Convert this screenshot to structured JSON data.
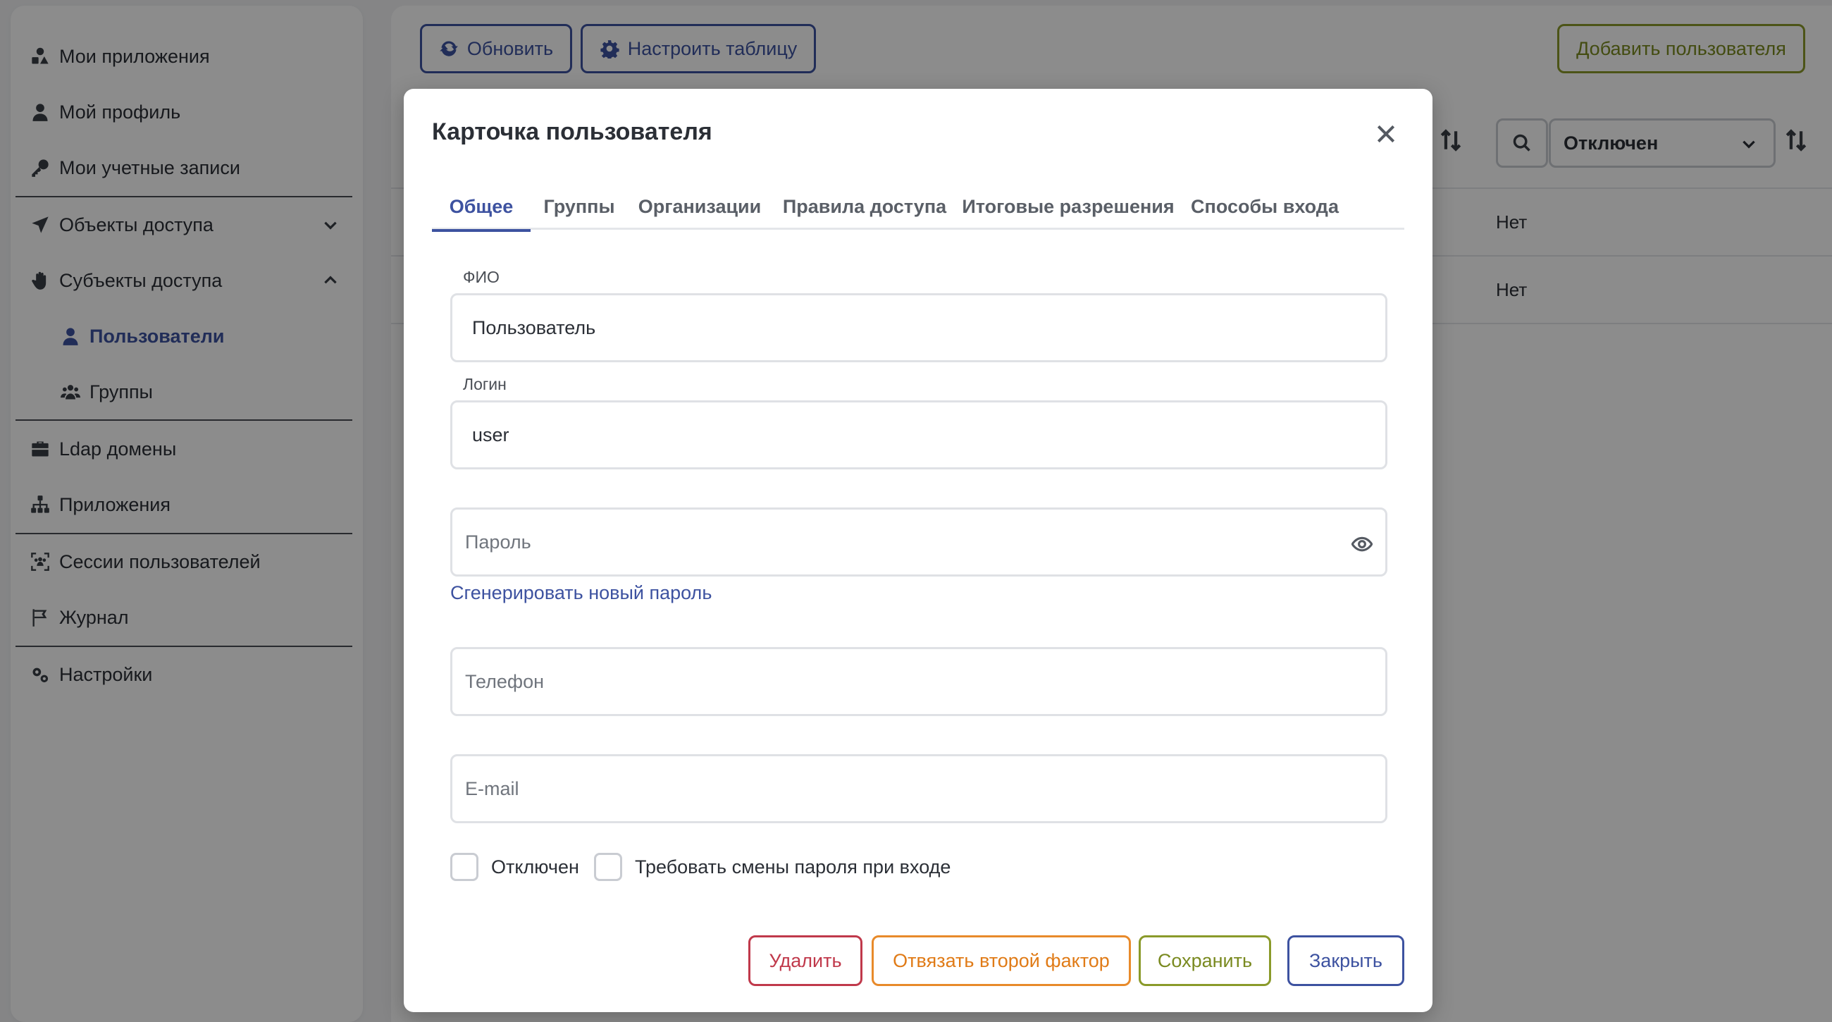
{
  "sidebar": {
    "items": [
      {
        "label": "Мои приложения",
        "icon": "apps-icon"
      },
      {
        "label": "Мой профиль",
        "icon": "user-icon"
      },
      {
        "label": "Мои учетные записи",
        "icon": "key-icon"
      },
      {
        "label": "Объекты доступа",
        "icon": "send-icon"
      },
      {
        "label": "Субъекты доступа",
        "icon": "hand-icon"
      },
      {
        "label": "Пользователи",
        "icon": "user-icon"
      },
      {
        "label": "Группы",
        "icon": "group-icon"
      },
      {
        "label": "Ldap домены",
        "icon": "briefcase-icon"
      },
      {
        "label": "Приложения",
        "icon": "sitemap-icon"
      },
      {
        "label": "Сессии пользователей",
        "icon": "sessions-icon"
      },
      {
        "label": "Журнал",
        "icon": "flag-icon"
      },
      {
        "label": "Настройки",
        "icon": "gears-icon"
      }
    ]
  },
  "toolbar": {
    "refresh_label": "Обновить",
    "configure_label": "Настроить таблицу",
    "add_user_label": "Добавить пользователя"
  },
  "table": {
    "filter_value": "Отключен",
    "rows": [
      {
        "disabled": "Нет"
      },
      {
        "disabled": "Нет"
      }
    ]
  },
  "modal": {
    "title": "Карточка пользователя",
    "tabs": [
      "Общее",
      "Группы",
      "Организации",
      "Правила доступа",
      "Итоговые разрешения",
      "Способы входа"
    ],
    "fio_label": "ФИО",
    "fio_value": "Пользователь",
    "login_label": "Логин",
    "login_value": "user",
    "password_placeholder": "Пароль",
    "generate_link": "Сгенерировать новый пароль",
    "phone_placeholder": "Телефон",
    "email_placeholder": "E-mail",
    "checkbox_disabled": "Отключен",
    "checkbox_require_change": "Требовать смены пароля при входе",
    "buttons": {
      "delete": "Удалить",
      "unbind": "Отвязать второй фактор",
      "save": "Сохранить",
      "close": "Закрыть"
    }
  },
  "colors": {
    "accent": "#3d52a0",
    "green": "#7a8a20",
    "danger": "#c0394b",
    "warning": "#e07b17"
  }
}
